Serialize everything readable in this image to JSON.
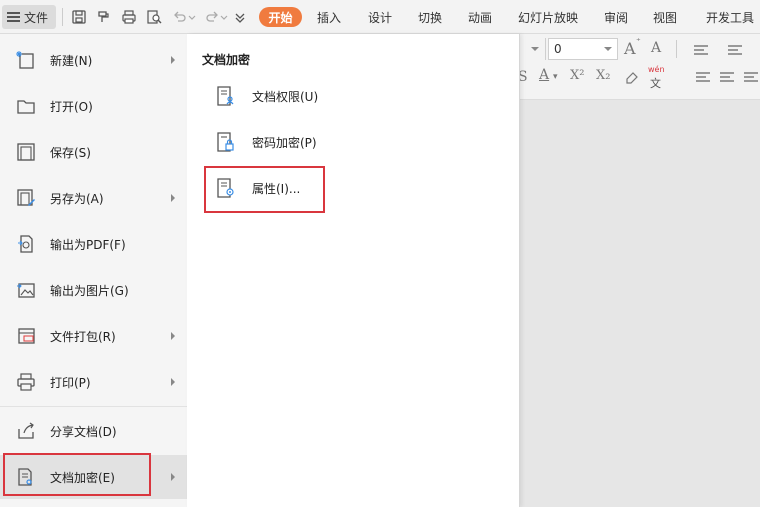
{
  "toolbar": {
    "file_label": "文件",
    "tabs": [
      "开始",
      "插入",
      "设计",
      "切换",
      "动画",
      "幻灯片放映",
      "审阅",
      "视图",
      "开发工具"
    ],
    "active_tab": "开始",
    "accent_color": "#f07b3f"
  },
  "ribbon": {
    "font_size_value": "0",
    "pinyin_glyph": "wén",
    "pinyin_char": "文"
  },
  "file_menu": {
    "items": [
      {
        "label": "新建(N)",
        "icon": "new-doc-icon",
        "has_submenu": true
      },
      {
        "label": "打开(O)",
        "icon": "folder-open-icon",
        "has_submenu": false
      },
      {
        "label": "保存(S)",
        "icon": "save-icon",
        "has_submenu": false
      },
      {
        "label": "另存为(A)",
        "icon": "save-as-icon",
        "has_submenu": true
      },
      {
        "label": "输出为PDF(F)",
        "icon": "export-pdf-icon",
        "has_submenu": false
      },
      {
        "label": "输出为图片(G)",
        "icon": "export-image-icon",
        "has_submenu": false
      },
      {
        "label": "文件打包(R)",
        "icon": "package-icon",
        "has_submenu": true
      },
      {
        "label": "打印(P)",
        "icon": "print-icon",
        "has_submenu": true
      },
      {
        "label": "分享文档(D)",
        "icon": "share-icon",
        "has_submenu": false
      },
      {
        "label": "文档加密(E)",
        "icon": "encrypt-doc-icon",
        "has_submenu": true,
        "active": true
      }
    ]
  },
  "submenu": {
    "title": "文档加密",
    "items": [
      {
        "label": "文档权限(U)",
        "icon": "doc-permission-icon"
      },
      {
        "label": "密码加密(P)",
        "icon": "password-lock-icon"
      },
      {
        "label": "属性(I)...",
        "icon": "doc-properties-icon"
      }
    ]
  },
  "highlight_color": "#d9363e"
}
